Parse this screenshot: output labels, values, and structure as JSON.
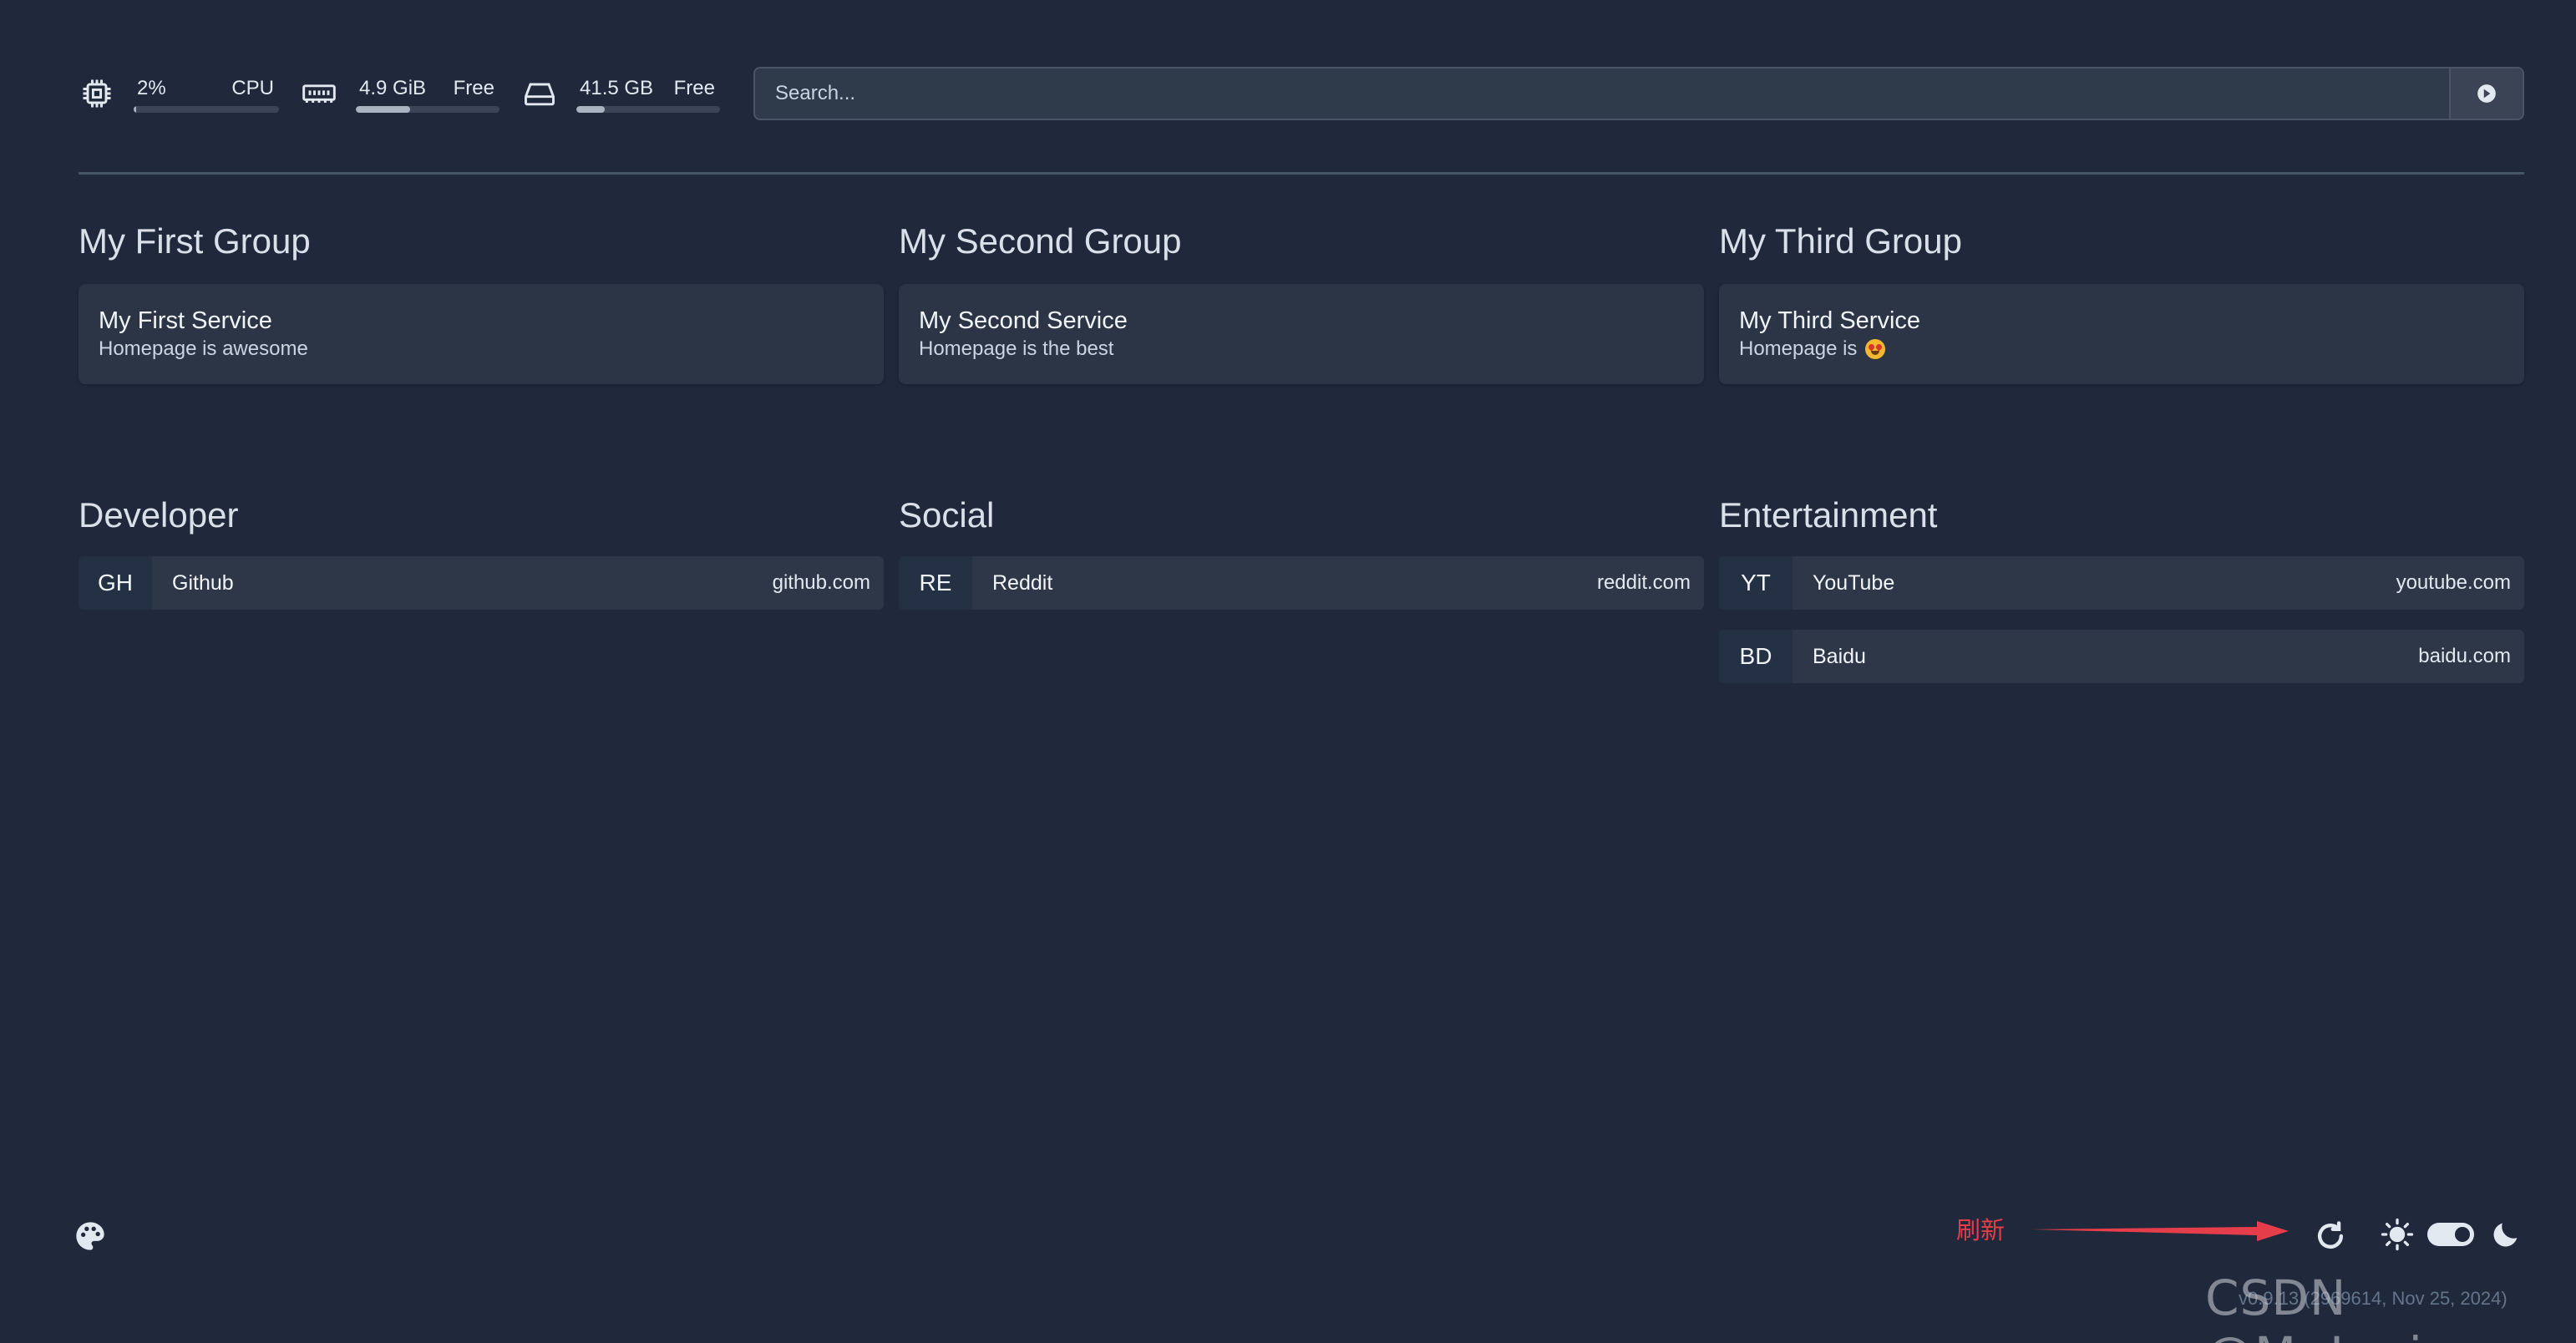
{
  "resources": {
    "cpu": {
      "value": "2%",
      "label": "CPU",
      "usage_fraction": 0.02
    },
    "memory": {
      "value": "4.9 GiB",
      "label": "Free",
      "usage_fraction": 0.38
    },
    "disk": {
      "value": "41.5 GB",
      "label": "Free",
      "usage_fraction": 0.2
    }
  },
  "search": {
    "placeholder": "Search..."
  },
  "service_groups": [
    {
      "title": "My First Group",
      "service": {
        "name": "My First Service",
        "description": "Homepage is awesome"
      }
    },
    {
      "title": "My Second Group",
      "service": {
        "name": "My Second Service",
        "description": "Homepage is the best"
      }
    },
    {
      "title": "My Third Group",
      "service": {
        "name": "My Third Service",
        "description": "Homepage is"
      }
    }
  ],
  "bookmark_groups": [
    {
      "title": "Developer",
      "items": [
        {
          "abbr": "GH",
          "name": "Github",
          "url": "github.com"
        }
      ]
    },
    {
      "title": "Social",
      "items": [
        {
          "abbr": "RE",
          "name": "Reddit",
          "url": "reddit.com"
        }
      ]
    },
    {
      "title": "Entertainment",
      "items": [
        {
          "abbr": "YT",
          "name": "YouTube",
          "url": "youtube.com"
        },
        {
          "abbr": "BD",
          "name": "Baidu",
          "url": "baidu.com"
        }
      ]
    }
  ],
  "footer": {
    "annotation": "刷新",
    "version": "v0.9.13 (2969614, Nov 25, 2024)",
    "theme_mode": "dark"
  },
  "watermark": "CSDN @Mr.Lrain",
  "icons": [
    "cpu-icon",
    "memory-icon",
    "disk-icon",
    "search-submit-icon",
    "palette-icon",
    "refresh-icon",
    "sun-icon",
    "moon-icon",
    "arrow-annotation",
    "emoji-star-struck"
  ],
  "colors": {
    "background": "#1f293b",
    "card": "#2b3546",
    "annotation": "#e53d4a"
  }
}
